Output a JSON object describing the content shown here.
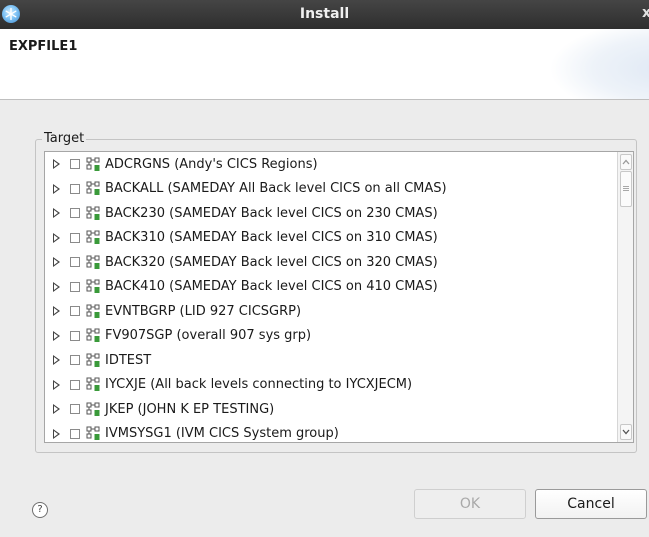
{
  "window": {
    "title": "Install",
    "close_glyph": "x",
    "app_icon": "snowflake-icon"
  },
  "banner": {
    "title": "EXPFILE1"
  },
  "target_group": {
    "label": "Target",
    "items": [
      {
        "label": "ADCRGNS (Andy's CICS Regions)",
        "checked": false
      },
      {
        "label": "BACKALL (SAMEDAY All Back level CICS on all CMAS)",
        "checked": false
      },
      {
        "label": "BACK230 (SAMEDAY Back level CICS on 230 CMAS)",
        "checked": false
      },
      {
        "label": "BACK310 (SAMEDAY Back level CICS on 310 CMAS)",
        "checked": false
      },
      {
        "label": "BACK320 (SAMEDAY Back level CICS on 320 CMAS)",
        "checked": false
      },
      {
        "label": "BACK410 (SAMEDAY Back level CICS on 410 CMAS)",
        "checked": false
      },
      {
        "label": "EVNTBGRP (LID 927 CICSGRP)",
        "checked": false
      },
      {
        "label": "FV907SGP (overall 907 sys grp)",
        "checked": false
      },
      {
        "label": "IDTEST",
        "checked": false
      },
      {
        "label": "IYCXJE (All back levels connecting to IYCXJECM)",
        "checked": false
      },
      {
        "label": "JKEP (JOHN K EP TESTING)",
        "checked": false
      },
      {
        "label": "IVMSYSG1 (IVM CICS System group)",
        "checked": false
      }
    ]
  },
  "footer": {
    "help_glyph": "?",
    "ok_label": "OK",
    "ok_enabled": false,
    "cancel_label": "Cancel"
  },
  "colors": {
    "titlebar": "#3a3a3a",
    "dialog_bg": "#ececec",
    "icon_green": "#3a9a3a"
  }
}
